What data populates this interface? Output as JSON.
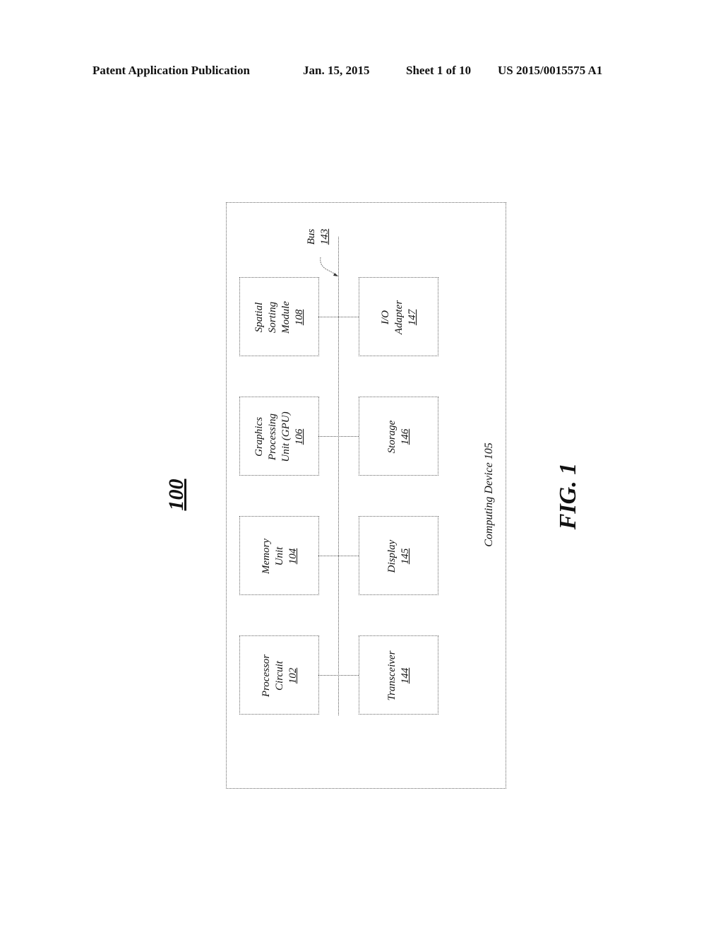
{
  "header": {
    "publication": "Patent Application Publication",
    "date": "Jan. 15, 2015",
    "sheet": "Sheet 1 of 10",
    "number": "US 2015/0015575 A1"
  },
  "figure": {
    "ref_number": "100",
    "caption": "FIG. 1",
    "container_label": "Computing Device 105",
    "bus": {
      "label": "Bus",
      "ref": "143"
    },
    "left_blocks": [
      {
        "lines": [
          "Processor",
          "Circuit"
        ],
        "ref": "102"
      },
      {
        "lines": [
          "Memory",
          "Unit"
        ],
        "ref": "104"
      },
      {
        "lines": [
          "Graphics",
          "Processing",
          "Unit (GPU)"
        ],
        "ref": "106"
      },
      {
        "lines": [
          "Spatial",
          "Sorting",
          "Module"
        ],
        "ref": "108"
      }
    ],
    "right_blocks": [
      {
        "lines": [
          "Transceiver"
        ],
        "ref": "144"
      },
      {
        "lines": [
          "Display"
        ],
        "ref": "145"
      },
      {
        "lines": [
          "Storage"
        ],
        "ref": "146"
      },
      {
        "lines": [
          "I/O",
          "Adapter"
        ],
        "ref": "147"
      }
    ]
  }
}
